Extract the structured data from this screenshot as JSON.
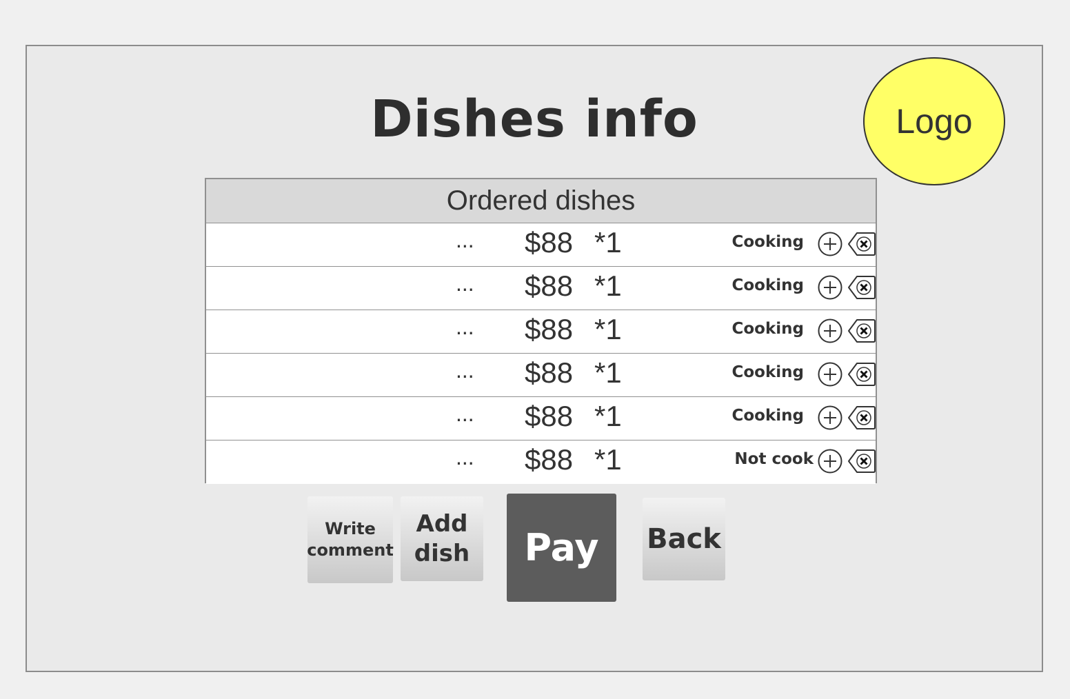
{
  "header": {
    "title": "Dishes info",
    "logo_label": "Logo"
  },
  "table": {
    "header": "Ordered dishes",
    "rows": [
      {
        "name": "...",
        "price": "$88",
        "qty": "*1",
        "status": "Cooking"
      },
      {
        "name": "...",
        "price": "$88",
        "qty": "*1",
        "status": "Cooking"
      },
      {
        "name": "...",
        "price": "$88",
        "qty": "*1",
        "status": "Cooking"
      },
      {
        "name": "...",
        "price": "$88",
        "qty": "*1",
        "status": "Cooking"
      },
      {
        "name": "...",
        "price": "$88",
        "qty": "*1",
        "status": "Cooking"
      },
      {
        "name": "...",
        "price": "$88",
        "qty": "*1",
        "status": "Not cook"
      }
    ]
  },
  "actions": {
    "write_comment_line1": "Write",
    "write_comment_line2": "comment",
    "add_dish_line1": "Add",
    "add_dish_line2": "dish",
    "pay": "Pay",
    "back": "Back"
  },
  "colors": {
    "logo_fill": "#ffff66",
    "pay_button": "#5c5c5c",
    "header_band": "#d9d9d9",
    "background": "#eaeaea"
  },
  "icons": {
    "row_add": "plus-circle-icon",
    "row_remove": "backspace-x-icon"
  }
}
